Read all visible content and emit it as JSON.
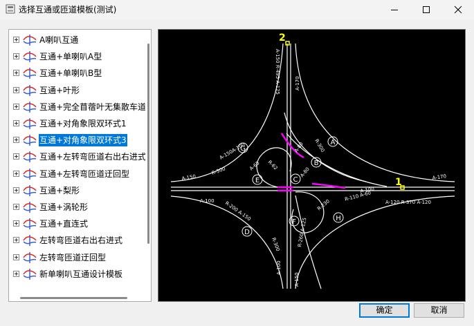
{
  "window": {
    "title": "选择互通或匝道模板(测试)"
  },
  "tree": {
    "selected_index": 6,
    "items": [
      {
        "label": "A喇叭互通"
      },
      {
        "label": "互通+单喇叭A型"
      },
      {
        "label": "互通+单喇叭B型"
      },
      {
        "label": "互通+叶形"
      },
      {
        "label": "互通+完全苜蓿叶无集散车道"
      },
      {
        "label": "互通+对角象限双环式1"
      },
      {
        "label": "互通+对角象限双环式3"
      },
      {
        "label": "互通+左转弯匝道右出右进式"
      },
      {
        "label": "互通+左转弯匝道迂回型"
      },
      {
        "label": "互通+梨形"
      },
      {
        "label": "互通+涡轮形"
      },
      {
        "label": "互通+直连式"
      },
      {
        "label": "左转弯匝道右出右进式"
      },
      {
        "label": "左转弯匝道迂回型"
      },
      {
        "label": "新单喇叭互通设计模板"
      }
    ]
  },
  "preview": {
    "ends": {
      "top": "2",
      "right": "1"
    },
    "regions": {
      "A": "A",
      "B": "B",
      "C": "C",
      "D": "D",
      "E": "E",
      "F": "F",
      "G": "G",
      "H": "H"
    },
    "labels": {
      "a150_r495": "A-150 R-495 A-125",
      "a170_top": "A-170",
      "r300_a": "R-300",
      "a80_b": "A-80",
      "a150a100": "A-150A-100",
      "a150_left": "A-150",
      "r300_left": "R-300",
      "a170_right": "A-170",
      "a100_right": "A-100",
      "r110_a60": "R-110 A-60",
      "a120_r370": "A-120 R-370 A-120",
      "r230": "R-230",
      "a100_left": "A-100",
      "r200_a150": "R-200 A-150",
      "r300_d": "R-300",
      "r260": "R-260 A-125",
      "a100_bottom": "A-100",
      "a150_bottom": "A-150",
      "r62": "R-62",
      "a65": "A-65",
      "a80_c": "A-80"
    },
    "colors": {
      "line": "#ffffff",
      "highlight": "#ff00ff",
      "endpoint": "#ffff00"
    }
  },
  "buttons": {
    "ok": "确定",
    "cancel": "取消"
  }
}
